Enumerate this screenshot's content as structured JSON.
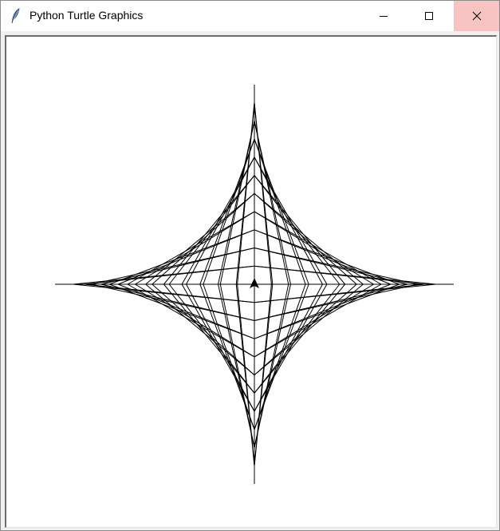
{
  "window": {
    "title": "Python Turtle Graphics",
    "controls": [
      "minimize",
      "maximize",
      "close"
    ],
    "close_hover_color": "#f7c3c3",
    "app_icon": "feather-icon"
  },
  "canvas": {
    "background": "#ffffff",
    "stroke_color": "#000000",
    "figure": "string-art astroid",
    "segments_per_quadrant": 11,
    "turtle": {
      "shape": "classic-arrow",
      "heading": "up"
    }
  }
}
